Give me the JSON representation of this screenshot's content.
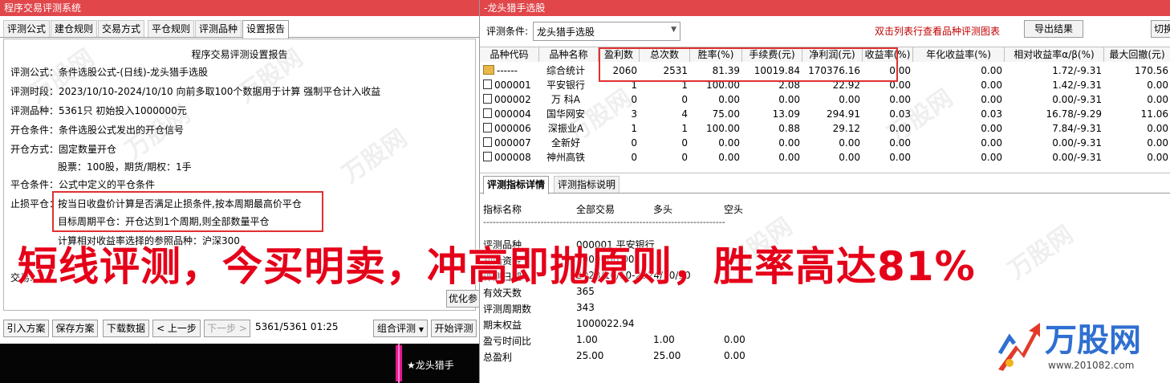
{
  "left": {
    "title": "程序交易评测系统",
    "tabs": [
      "评测公式",
      "建仓规则",
      "交易方式",
      "平仓规则",
      "评测品种",
      "设置报告"
    ],
    "report_title": "程序交易评测设置报告",
    "lines": [
      "评测公式：条件选股公式-(日线)-龙头猎手选股",
      "评测时段：2023/10/10-2024/10/10 向前多取100个数据用于计算 强制平仓计入收益",
      "评测品种：5361只 初始投入1000000元",
      "开仓条件：条件选股公式发出的开仓信号",
      "开仓方式：固定数量开仓",
      "股票：100股，期货/期权：1手",
      "平仓条件：公式中定义的平仓条件",
      "止损平仓：",
      "按当日收盘价计算是否满足止损条件,按本周期最高价平仓",
      "目标周期平仓：开仓达到1个周期,则全部数量平仓",
      "计算相对收益率选择的参照品种：沪深300",
      "交易..."
    ],
    "optimize_button": "优化参",
    "buttons": [
      "引入方案",
      "保存方案",
      "下载数据",
      "< 上一步",
      "下一步 >"
    ],
    "progress_text": "5361/5361  01:25",
    "combo_button": "组合评测",
    "start_button": "开始评测",
    "strip_label": "★龙头猎手"
  },
  "right": {
    "title": "-龙头猎手选股",
    "condition_label": "评测条件:",
    "condition_value": "龙头猎手选股",
    "hint": "双击列表行查看品种评测图表",
    "export_button": "导出结果",
    "switch_button": "切换",
    "columns": [
      "品种代码",
      "品种名称",
      "盈利数",
      "总次数",
      "胜率(%)",
      "手续费(元)",
      "净利润(元)",
      "收益率(%)",
      "年化收益率(%)",
      "相对收益率α/β(%)",
      "最大回撤(元)"
    ],
    "rows": [
      [
        "------",
        "综合统计",
        "2060",
        "2531",
        "81.39",
        "10019.84",
        "170376.16",
        "0.00",
        "0.00",
        "1.72/-9.31",
        "170.56"
      ],
      [
        "000001",
        "平安银行",
        "1",
        "1",
        "100.00",
        "2.08",
        "22.92",
        "0.00",
        "0.00",
        "1.42/-9.31",
        "0.00"
      ],
      [
        "000002",
        "万 科A",
        "0",
        "0",
        "0.00",
        "0.00",
        "0.00",
        "0.00",
        "0.00",
        "0.00/-9.31",
        "0.00"
      ],
      [
        "000004",
        "国华网安",
        "3",
        "4",
        "75.00",
        "13.09",
        "294.91",
        "0.03",
        "0.03",
        "16.78/-9.29",
        "11.06"
      ],
      [
        "000006",
        "深振业A",
        "1",
        "1",
        "100.00",
        "0.88",
        "29.12",
        "0.00",
        "0.00",
        "7.84/-9.31",
        "0.00"
      ],
      [
        "000007",
        "全新好",
        "0",
        "0",
        "0.00",
        "0.00",
        "0.00",
        "0.00",
        "0.00",
        "0.00/-9.31",
        "0.00"
      ],
      [
        "000008",
        "神州高铁",
        "0",
        "0",
        "0.00",
        "0.00",
        "0.00",
        "0.00",
        "0.00",
        "0.00/-9.31",
        "0.00"
      ]
    ],
    "detail_tabs": [
      "评测指标详情",
      "评测指标说明"
    ],
    "detail_header": [
      "指标名称",
      "全部交易",
      "多头",
      "空头"
    ],
    "separator": "----------------------------------------------------------------------------",
    "detail_rows": [
      [
        "评测品种",
        "000001 平安银行",
        "",
        ""
      ],
      [
        "初始资金",
        "1000000.00",
        "",
        ""
      ],
      [
        "评测日期",
        "2023/10/10-2024/10/10",
        "",
        ""
      ],
      [
        "有效天数",
        "365",
        "",
        ""
      ],
      [
        "评测周期数",
        "343",
        "",
        ""
      ],
      [
        "期末权益",
        "1000022.94",
        "",
        ""
      ],
      [
        "盈亏时间比",
        "1.00",
        "1.00",
        "0.00"
      ],
      [
        "总盈利",
        "25.00",
        "25.00",
        "0.00"
      ]
    ]
  },
  "overlay_text": "短线评测，今买明卖，冲高即抛原则，胜率高达81%",
  "logo": {
    "name": "万股网",
    "url": "www.201082.com"
  },
  "watermark": "万股网",
  "colors": {
    "title_bg": "#e0464a",
    "highlight": "#e03030",
    "overlay": "#e50019",
    "logo_blue": "#2f6fd1",
    "hint": "#c00000"
  }
}
